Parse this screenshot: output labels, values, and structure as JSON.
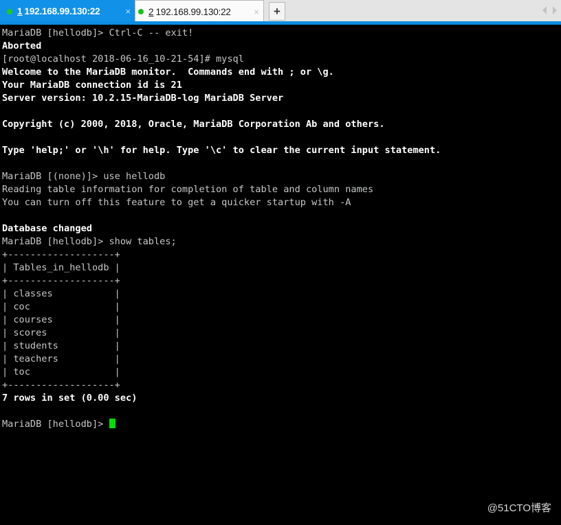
{
  "tabbar": {
    "tabs": [
      {
        "number": "1",
        "address": "192.168.99.130:22",
        "close_label": "×",
        "status": "connected",
        "active": true
      },
      {
        "number": "2",
        "address": "192.168.99.130:22",
        "close_label": "×",
        "status": "connected",
        "active": false
      }
    ],
    "new_tab_label": "+",
    "scroll_left_label": "◀",
    "scroll_right_label": "▶",
    "accent_color": "#0d8ce2",
    "status_dot_color": "#16c217"
  },
  "terminal": {
    "background_color": "#000000",
    "text_color": "#c5c8c6",
    "bold_color": "#ffffff",
    "cursor_color": "#00e000",
    "lines": [
      {
        "text": "MariaDB [hellodb]> Ctrl-C -- exit!",
        "bold": false
      },
      {
        "text": "Aborted",
        "bold": true
      },
      {
        "text": "[root@localhost 2018-06-16_10-21-54]# mysql",
        "bold": false
      },
      {
        "text": "Welcome to the MariaDB monitor.  Commands end with ; or \\g.",
        "bold": true
      },
      {
        "text": "Your MariaDB connection id is 21",
        "bold": true
      },
      {
        "text": "Server version: 10.2.15-MariaDB-log MariaDB Server",
        "bold": true
      },
      {
        "text": "",
        "bold": false
      },
      {
        "text": "Copyright (c) 2000, 2018, Oracle, MariaDB Corporation Ab and others.",
        "bold": true
      },
      {
        "text": "",
        "bold": false
      },
      {
        "text": "Type 'help;' or '\\h' for help. Type '\\c' to clear the current input statement.",
        "bold": true
      },
      {
        "text": "",
        "bold": false
      },
      {
        "text": "MariaDB [(none)]> use hellodb",
        "bold": false
      },
      {
        "text": "Reading table information for completion of table and column names",
        "bold": false
      },
      {
        "text": "You can turn off this feature to get a quicker startup with -A",
        "bold": false
      },
      {
        "text": "",
        "bold": false
      },
      {
        "text": "Database changed",
        "bold": true
      },
      {
        "text": "MariaDB [hellodb]> show tables;",
        "bold": false
      },
      {
        "text": "+-------------------+",
        "bold": false
      },
      {
        "text": "| Tables_in_hellodb |",
        "bold": false
      },
      {
        "text": "+-------------------+",
        "bold": false
      },
      {
        "text": "| classes           |",
        "bold": false
      },
      {
        "text": "| coc               |",
        "bold": false
      },
      {
        "text": "| courses           |",
        "bold": false
      },
      {
        "text": "| scores            |",
        "bold": false
      },
      {
        "text": "| students          |",
        "bold": false
      },
      {
        "text": "| teachers          |",
        "bold": false
      },
      {
        "text": "| toc               |",
        "bold": false
      },
      {
        "text": "+-------------------+",
        "bold": false
      },
      {
        "text": "7 rows in set (0.00 sec)",
        "bold": true
      },
      {
        "text": "",
        "bold": false
      }
    ],
    "prompt": "MariaDB [hellodb]> ",
    "query_result": {
      "column_header": "Tables_in_hellodb",
      "rows": [
        "classes",
        "coc",
        "courses",
        "scores",
        "students",
        "teachers",
        "toc"
      ],
      "row_count_text": "7 rows in set (0.00 sec)"
    }
  },
  "watermark": {
    "text": "@51CTO博客"
  }
}
